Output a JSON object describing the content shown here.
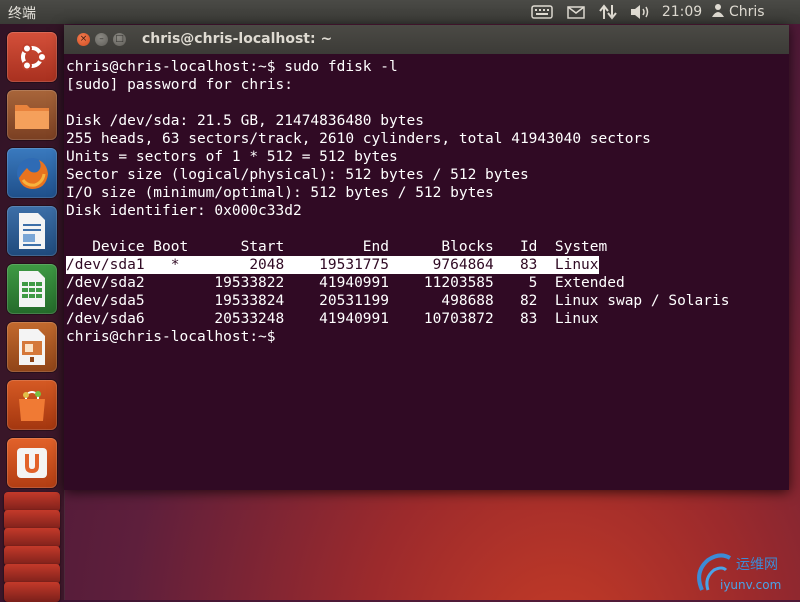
{
  "top_panel": {
    "title": "终端",
    "clock": "21:09",
    "user": "Chris",
    "icons": [
      "keyboard-icon",
      "mail-icon",
      "network-icon",
      "volume-icon",
      "user-icon"
    ]
  },
  "launcher": {
    "items": [
      "dash-home",
      "files",
      "firefox",
      "libreoffice-writer",
      "libreoffice-calc",
      "libreoffice-impress",
      "software-center",
      "ubuntu-one"
    ]
  },
  "window": {
    "title": "chris@chris-localhost: ~"
  },
  "terminal": {
    "lines": [
      "chris@chris-localhost:~$ sudo fdisk -l",
      "[sudo] password for chris:",
      "",
      "Disk /dev/sda: 21.5 GB, 21474836480 bytes",
      "255 heads, 63 sectors/track, 2610 cylinders, total 41943040 sectors",
      "Units = sectors of 1 * 512 = 512 bytes",
      "Sector size (logical/physical): 512 bytes / 512 bytes",
      "I/O size (minimum/optimal): 512 bytes / 512 bytes",
      "Disk identifier: 0x000c33d2",
      "",
      "   Device Boot      Start         End      Blocks   Id  System",
      "/dev/sda1   *        2048    19531775     9764864   83  Linux",
      "/dev/sda2        19533822    41940991    11203585    5  Extended",
      "/dev/sda5        19533824    20531199      498688   82  Linux swap / Solaris",
      "/dev/sda6        20533248    41940991    10703872   83  Linux",
      "chris@chris-localhost:~$ "
    ],
    "highlighted_line": 11
  },
  "watermark": {
    "text": "运维网",
    "url": "iyunv.com"
  },
  "colors": {
    "terminal_bg": "#300a24",
    "terminal_fg": "#ffffff",
    "panel_bg": "#3c3b37",
    "close_button": "#e0562c"
  }
}
